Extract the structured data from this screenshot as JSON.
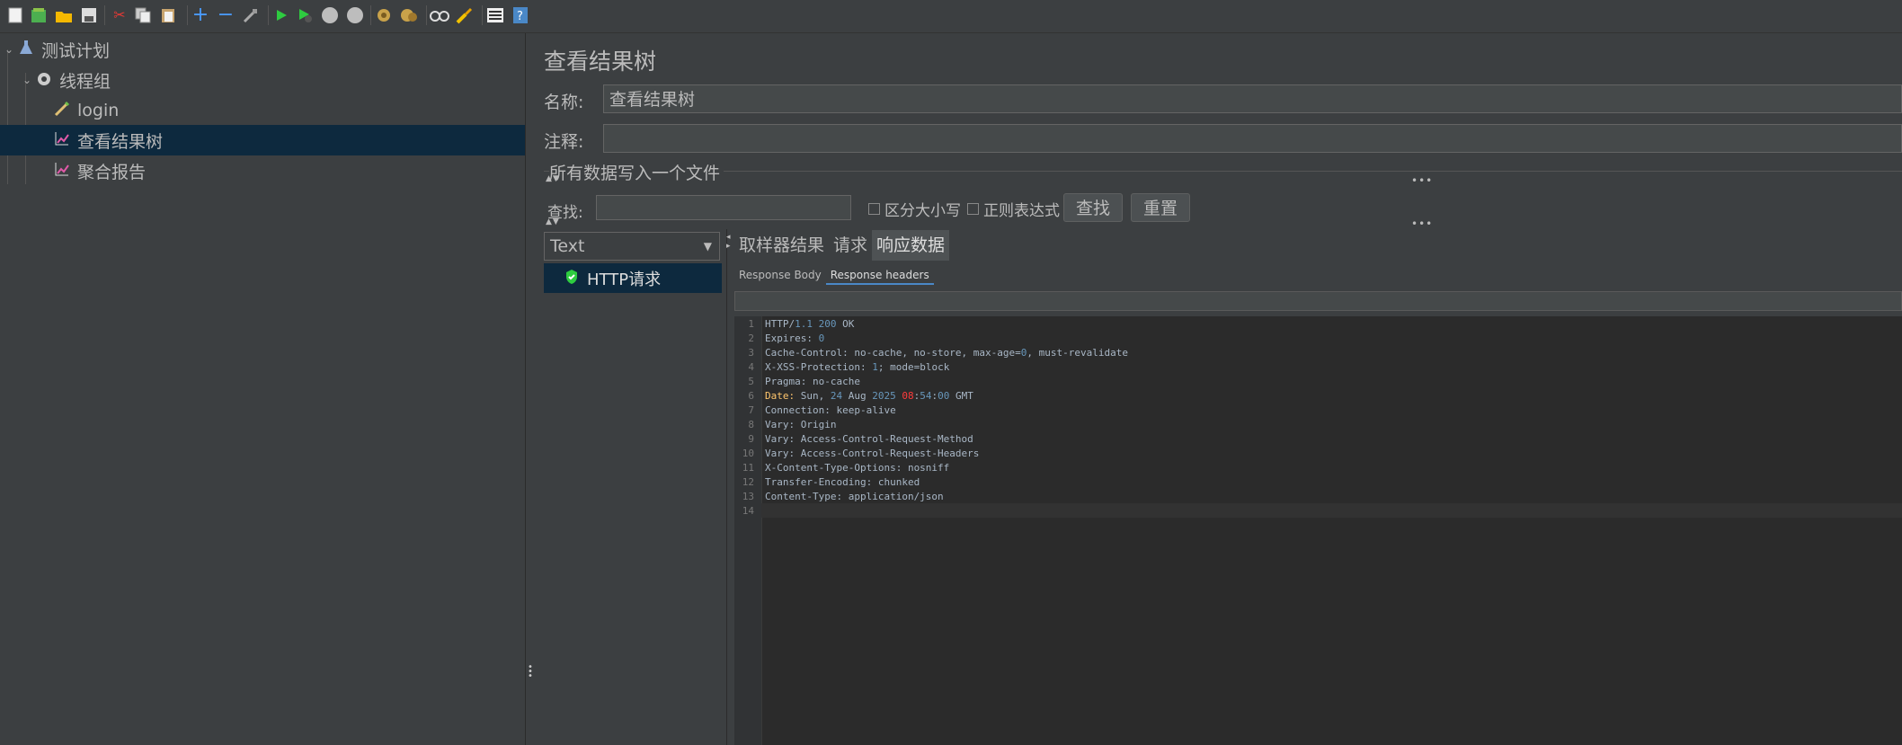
{
  "toolbar": {
    "icons": [
      "new-icon",
      "templates-icon",
      "open-icon",
      "save-icon",
      "cut-icon",
      "copy-icon",
      "paste-icon",
      "expand-icon",
      "collapse-icon",
      "toggle-icon",
      "start-icon",
      "start-no-pause-icon",
      "stop-icon",
      "shutdown-icon",
      "clear-icon",
      "clear-all-icon",
      "search-icon",
      "reset-search-icon",
      "function-helper-icon",
      "help-icon"
    ]
  },
  "tree": {
    "items": [
      {
        "label": "测试计划",
        "icon": "test-plan-icon",
        "level": 0,
        "expanded": true
      },
      {
        "label": "线程组",
        "icon": "thread-group-icon",
        "level": 1,
        "expanded": true
      },
      {
        "label": "login",
        "icon": "sampler-icon",
        "level": 2
      },
      {
        "label": "查看结果树",
        "icon": "listener-icon",
        "level": 2,
        "selected": true
      },
      {
        "label": "聚合报告",
        "icon": "listener-icon",
        "level": 2
      }
    ]
  },
  "panel": {
    "title": "查看结果树",
    "name_label": "名称:",
    "name_value": "查看结果树",
    "comment_label": "注释:",
    "comment_value": "",
    "file_group_label": "所有数据写入一个文件",
    "search_label": "查找:",
    "search_value": "",
    "case_sensitive_label": "区分大小写",
    "regex_label": "正则表达式",
    "find_button": "查找",
    "reset_button": "重置",
    "renderer": "Text",
    "results": [
      {
        "label": "HTTP请求",
        "status": "success"
      }
    ],
    "tabs": [
      "取样器结果",
      "请求",
      "响应数据"
    ],
    "active_tab": "响应数据",
    "subtabs": [
      "Response Body",
      "Response headers"
    ],
    "active_subtab": "Response headers"
  },
  "response_headers": [
    "HTTP/1.1 200 OK",
    "Expires: 0",
    "Cache-Control: no-cache, no-store, max-age=0, must-revalidate",
    "X-XSS-Protection: 1; mode=block",
    "Pragma: no-cache",
    "Date: Sun, 24 Aug 2025 08:54:00 GMT",
    "Connection: keep-alive",
    "Vary: Origin",
    "Vary: Access-Control-Request-Method",
    "Vary: Access-Control-Request-Headers",
    "X-Content-Type-Options: nosniff",
    "Transfer-Encoding: chunked",
    "Content-Type: application/json",
    ""
  ]
}
